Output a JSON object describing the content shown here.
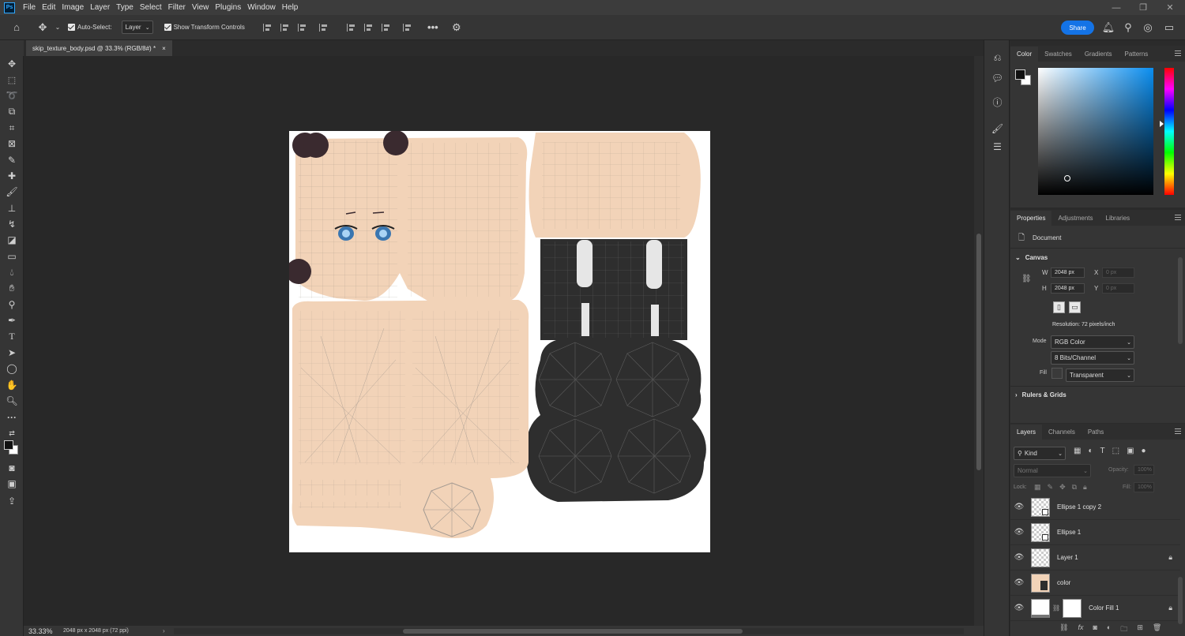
{
  "app": {
    "logo": "Ps"
  },
  "menu": [
    "File",
    "Edit",
    "Image",
    "Layer",
    "Type",
    "Select",
    "Filter",
    "View",
    "Plugins",
    "Window",
    "Help"
  ],
  "options": {
    "auto_select_label": "Auto-Select:",
    "auto_select_target": "Layer",
    "show_transform_label": "Show Transform Controls",
    "share_label": "Share"
  },
  "document": {
    "tab_title": "skip_texture_body.psd @ 33.3% (RGB/8#) *",
    "close": "×"
  },
  "status": {
    "zoom": "33.33%",
    "info": "2048 px x 2048 px (72 ppi)"
  },
  "color_panel": {
    "tabs": [
      "Color",
      "Swatches",
      "Gradients",
      "Patterns"
    ],
    "active_tab": "Color",
    "hue_base": "#0a8ef0"
  },
  "properties_panel": {
    "tabs": [
      "Properties",
      "Adjustments",
      "Libraries"
    ],
    "active_tab": "Properties",
    "doc_label": "Document",
    "canvas_section": "Canvas",
    "w_label": "W",
    "w_value": "2048 px",
    "h_label": "H",
    "h_value": "2048 px",
    "x_label": "X",
    "x_placeholder": "0 px",
    "y_label": "Y",
    "y_placeholder": "0 px",
    "resolution": "Resolution: 72 pixels/inch",
    "mode_label": "Mode",
    "mode_value": "RGB Color",
    "bits_value": "8 Bits/Channel",
    "fill_label": "Fill",
    "fill_value": "Transparent",
    "rulers_section": "Rulers & Grids"
  },
  "layers_panel": {
    "tabs": [
      "Layers",
      "Channels",
      "Paths"
    ],
    "active_tab": "Layers",
    "filter_kind": "Kind",
    "blend_mode": "Normal",
    "opacity_label": "Opacity:",
    "opacity_value": "100%",
    "lock_label": "Lock:",
    "fill_label": "Fill:",
    "fill_value": "100%",
    "layers": [
      {
        "name": "Ellipse 1 copy 2",
        "locked": false
      },
      {
        "name": "Ellipse 1",
        "locked": false
      },
      {
        "name": "Layer 1",
        "locked": true
      },
      {
        "name": "color",
        "locked": false
      },
      {
        "name": "Color Fill 1",
        "locked": true
      }
    ]
  },
  "colors": {
    "skin": "#f2d3b8",
    "dark_fabric": "#2e2e2e",
    "hair": "#3a2a2f",
    "accent": "#1473e6"
  }
}
